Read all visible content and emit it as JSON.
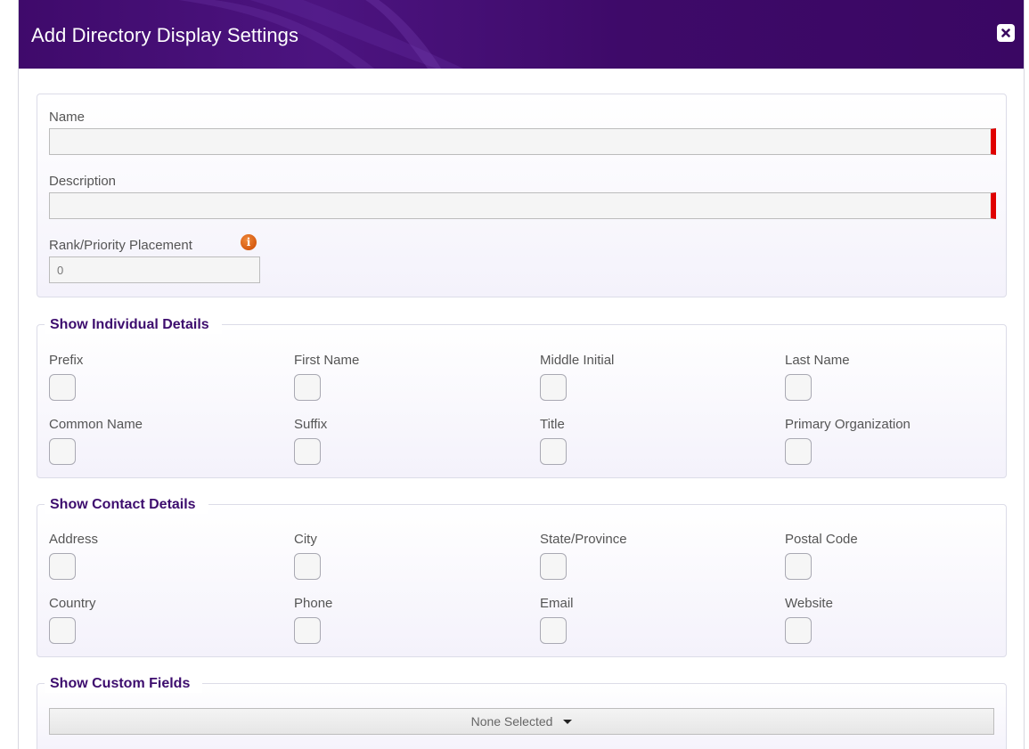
{
  "dialog": {
    "title": "Add Directory Display Settings",
    "colors": {
      "header": "#3f0a6b",
      "accent": "#3d0d6e",
      "required": "#e00000",
      "info": "#d65a10"
    }
  },
  "basic": {
    "name_label": "Name",
    "name_value": "",
    "description_label": "Description",
    "description_value": "",
    "rank_label": "Rank/Priority Placement",
    "rank_value": "0"
  },
  "individual": {
    "title": "Show Individual Details",
    "fields": [
      {
        "label": "Prefix"
      },
      {
        "label": "First Name"
      },
      {
        "label": "Middle Initial"
      },
      {
        "label": "Last Name"
      },
      {
        "label": "Common Name"
      },
      {
        "label": "Suffix"
      },
      {
        "label": "Title"
      },
      {
        "label": "Primary Organization"
      }
    ]
  },
  "contact": {
    "title": "Show Contact Details",
    "fields": [
      {
        "label": "Address"
      },
      {
        "label": "City"
      },
      {
        "label": "State/Province"
      },
      {
        "label": "Postal Code"
      },
      {
        "label": "Country"
      },
      {
        "label": "Phone"
      },
      {
        "label": "Email"
      },
      {
        "label": "Website"
      }
    ]
  },
  "custom": {
    "title": "Show Custom Fields",
    "selected_text": "None Selected"
  }
}
